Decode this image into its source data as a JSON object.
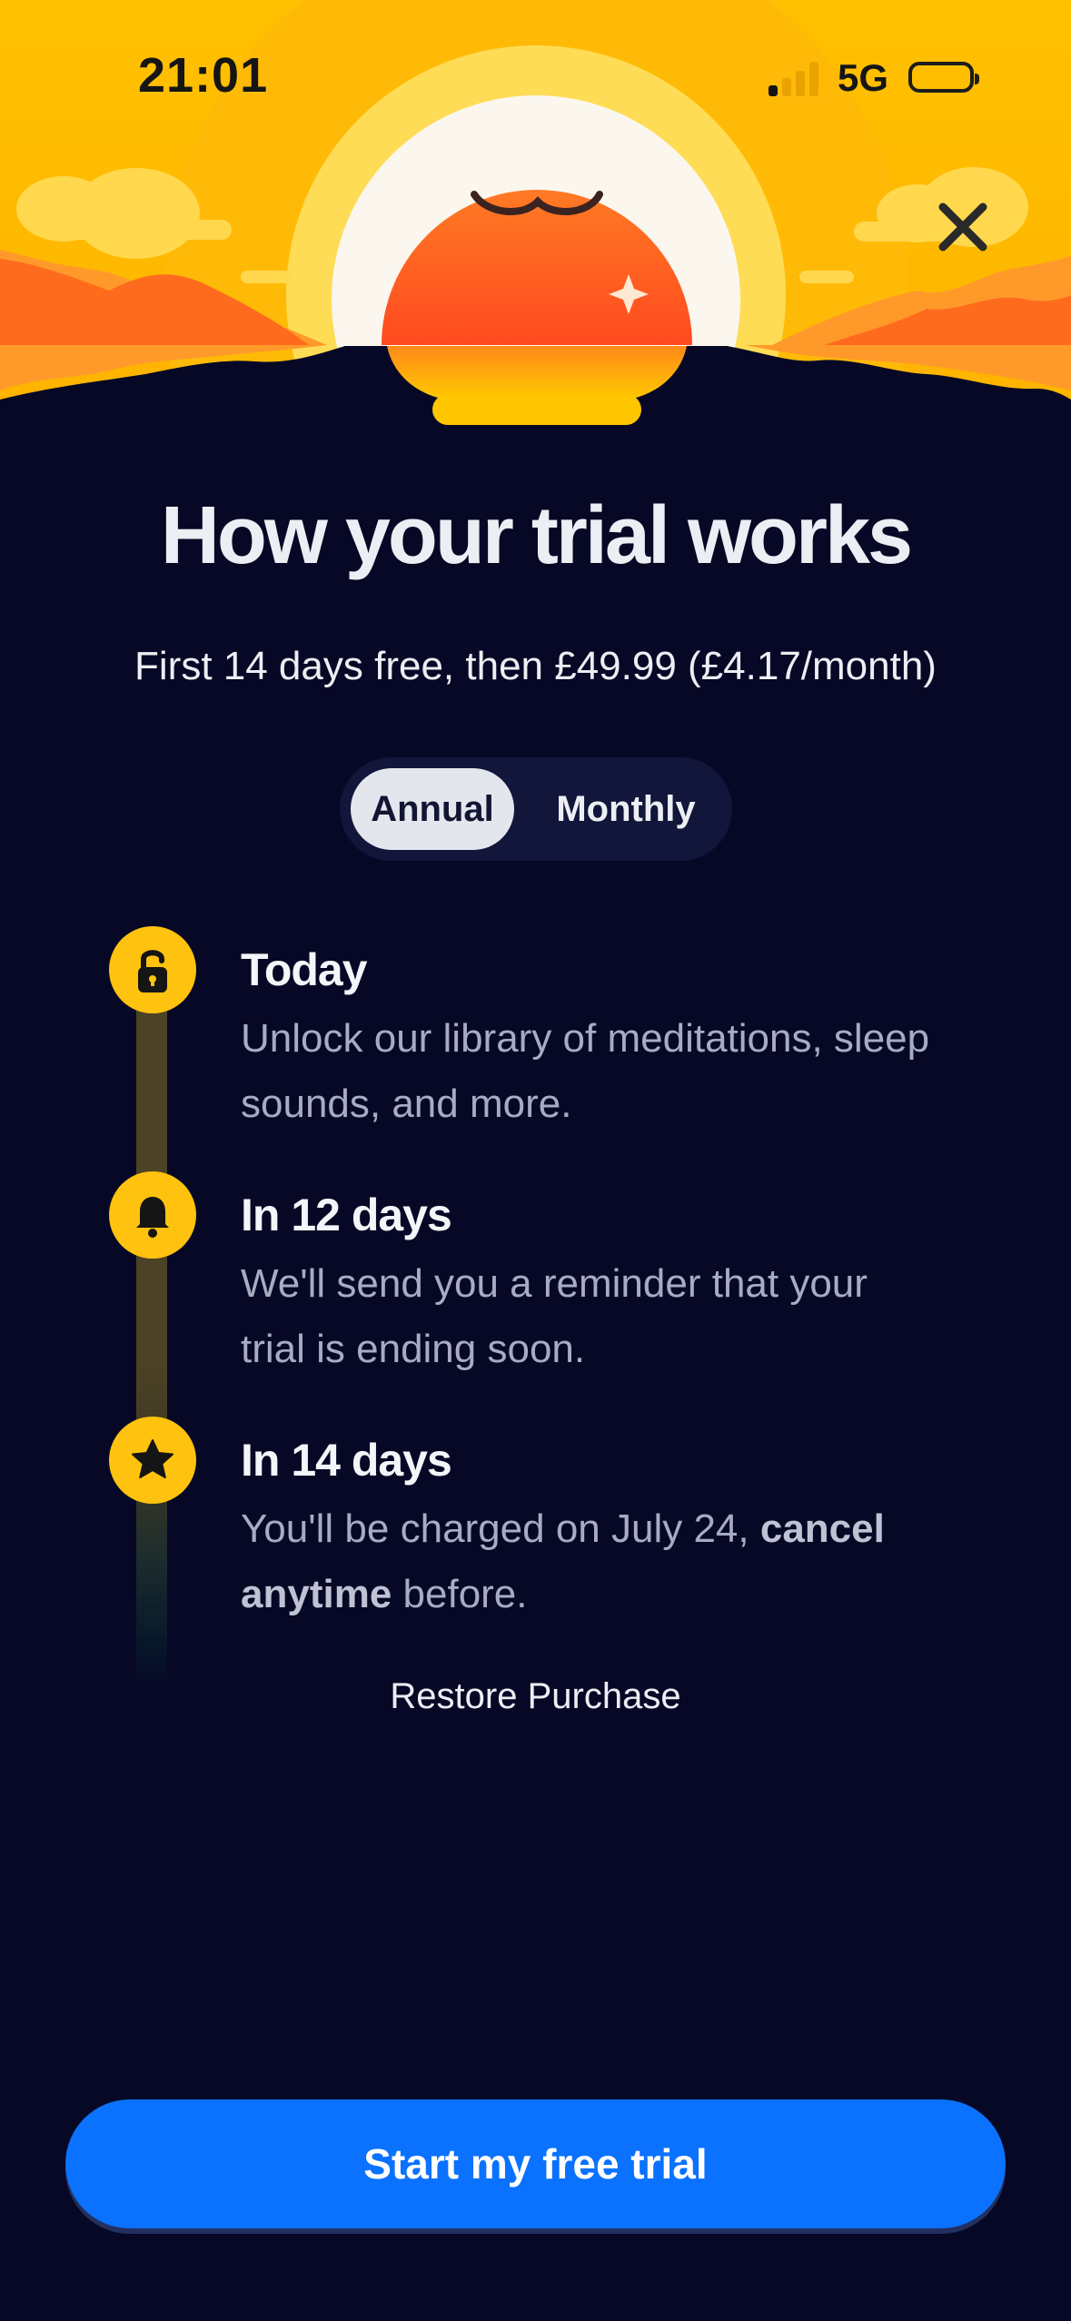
{
  "status_bar": {
    "time": "21:01",
    "network": "5G",
    "signal_icon": "signal-bars-icon",
    "battery_icon": "battery-icon"
  },
  "hero": {
    "illustration": "sunrise-headspace-illustration",
    "close_icon": "close-icon"
  },
  "main": {
    "title": "How your trial works",
    "subtitle": "First 14 days free, then £49.99 (£4.17/month)"
  },
  "plan_toggle": {
    "options": [
      "Annual",
      "Monthly"
    ],
    "selected": "Annual"
  },
  "timeline": [
    {
      "icon": "unlock-icon",
      "title": "Today",
      "text": "Unlock our library of meditations, sleep sounds, and more."
    },
    {
      "icon": "bell-icon",
      "title": "In 12 days",
      "text": "We'll send you a reminder that your trial is ending soon."
    },
    {
      "icon": "star-icon",
      "title": "In 14 days",
      "text_prefix": "You'll be charged on July 24, ",
      "text_bold": "cancel anytime",
      "text_suffix": " before."
    }
  ],
  "restore_label": "Restore Purchase",
  "cta_label": "Start my free trial",
  "colors": {
    "background": "#060826",
    "accent_yellow": "#ffc20e",
    "cta_blue": "#0a72ff",
    "sun_orange": "#ff6a2a"
  }
}
